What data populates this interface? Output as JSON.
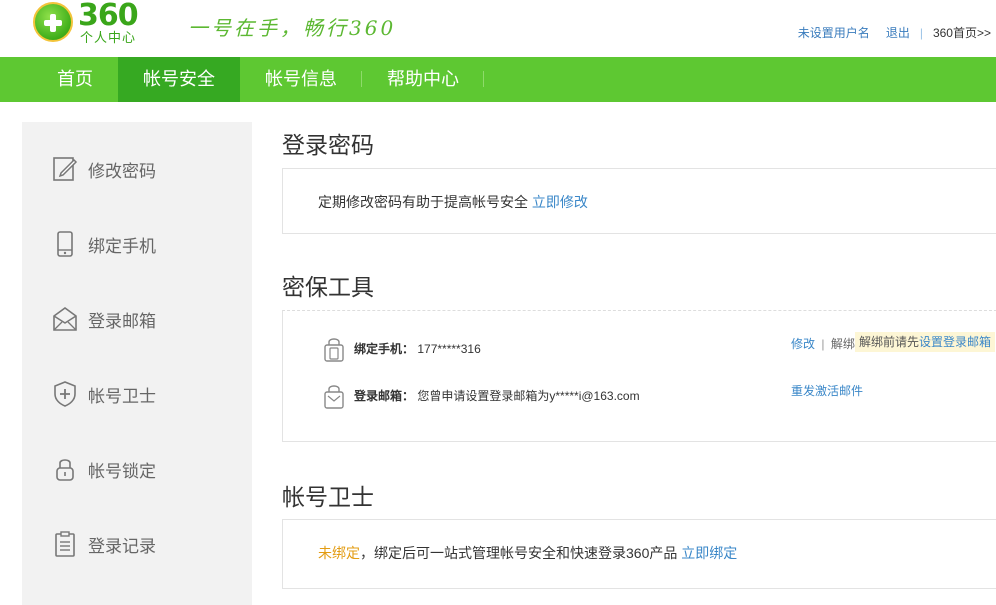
{
  "header": {
    "logo_number": "360",
    "logo_subtitle": "个人中心",
    "slogan": "一号在手，畅行360",
    "links": {
      "set_username": "未设置用户名",
      "logout": "退出",
      "separator": "|",
      "home": "360首页>>"
    }
  },
  "nav": {
    "items": [
      {
        "label": "首页"
      },
      {
        "label": "帐号安全"
      },
      {
        "label": "帐号信息"
      },
      {
        "label": "帮助中心"
      }
    ],
    "active_index": 1
  },
  "sidebar": {
    "items": [
      {
        "label": "修改密码",
        "icon": "edit-icon"
      },
      {
        "label": "绑定手机",
        "icon": "phone-icon"
      },
      {
        "label": "登录邮箱",
        "icon": "mail-icon"
      },
      {
        "label": "帐号卫士",
        "icon": "shield-icon"
      },
      {
        "label": "帐号锁定",
        "icon": "lock-icon"
      },
      {
        "label": "登录记录",
        "icon": "clipboard-icon"
      }
    ]
  },
  "login_password": {
    "title": "登录密码",
    "text": "定期修改密码有助于提高帐号安全",
    "link": "立即修改"
  },
  "security_tools": {
    "title": "密保工具",
    "phone": {
      "label": "绑定手机：",
      "value": "177*****316",
      "modify": "修改",
      "divider": "|",
      "unbind": "解绑",
      "tip_prefix": "解绑前请先",
      "tip_link": "设置登录邮箱"
    },
    "email": {
      "label": "登录邮箱：",
      "value": "您曾申请设置登录邮箱为y*****i@163.com",
      "resend": "重发激活邮件"
    }
  },
  "account_guard": {
    "title": "帐号卫士",
    "status": "未绑定",
    "text": "，绑定后可一站式管理帐号安全和快速登录360产品",
    "link": "立即绑定"
  },
  "colors": {
    "nav_bg": "#5ec832",
    "nav_active": "#36a922",
    "link": "#3a87c8",
    "warning": "#e39c12"
  }
}
